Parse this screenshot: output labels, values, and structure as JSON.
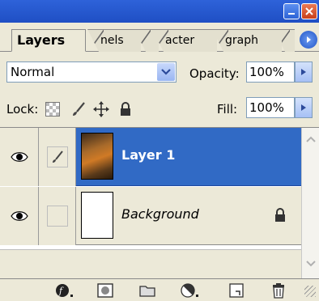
{
  "window": {
    "buttons": [
      {
        "name": "minimize-button",
        "icon": "minimize-icon"
      },
      {
        "name": "close-button",
        "icon": "close-icon"
      }
    ]
  },
  "tabs": [
    {
      "label": "Layers",
      "active": true
    },
    {
      "label": "nels",
      "active": false
    },
    {
      "label": "",
      "active": false
    },
    {
      "label": "acter",
      "active": false
    },
    {
      "label": "graph",
      "active": false
    },
    {
      "label": "",
      "active": false
    }
  ],
  "blend": {
    "mode": "Normal",
    "opacity_label": "Opacity:",
    "opacity_value": "100%"
  },
  "lock": {
    "label": "Lock:",
    "fill_label": "Fill:",
    "fill_value": "100%",
    "icons": [
      "lock-transparent-icon",
      "lock-image-icon",
      "lock-position-icon",
      "lock-all-icon"
    ]
  },
  "layers": [
    {
      "name": "Layer 1",
      "selected": true,
      "visible": true,
      "linked_brush": true,
      "thumbnail": "photo"
    },
    {
      "name": "Background",
      "selected": false,
      "visible": true,
      "linked_brush": false,
      "thumbnail": "white",
      "locked": true
    }
  ],
  "bottom_toolbar": {
    "icons": [
      "layer-style-icon",
      "add-mask-icon",
      "new-group-icon",
      "adjustment-layer-icon",
      "new-layer-icon",
      "delete-layer-icon"
    ]
  },
  "colors": {
    "titlebar": "#2e62d9",
    "selection": "#316ac5",
    "panel": "#ece9d8"
  }
}
